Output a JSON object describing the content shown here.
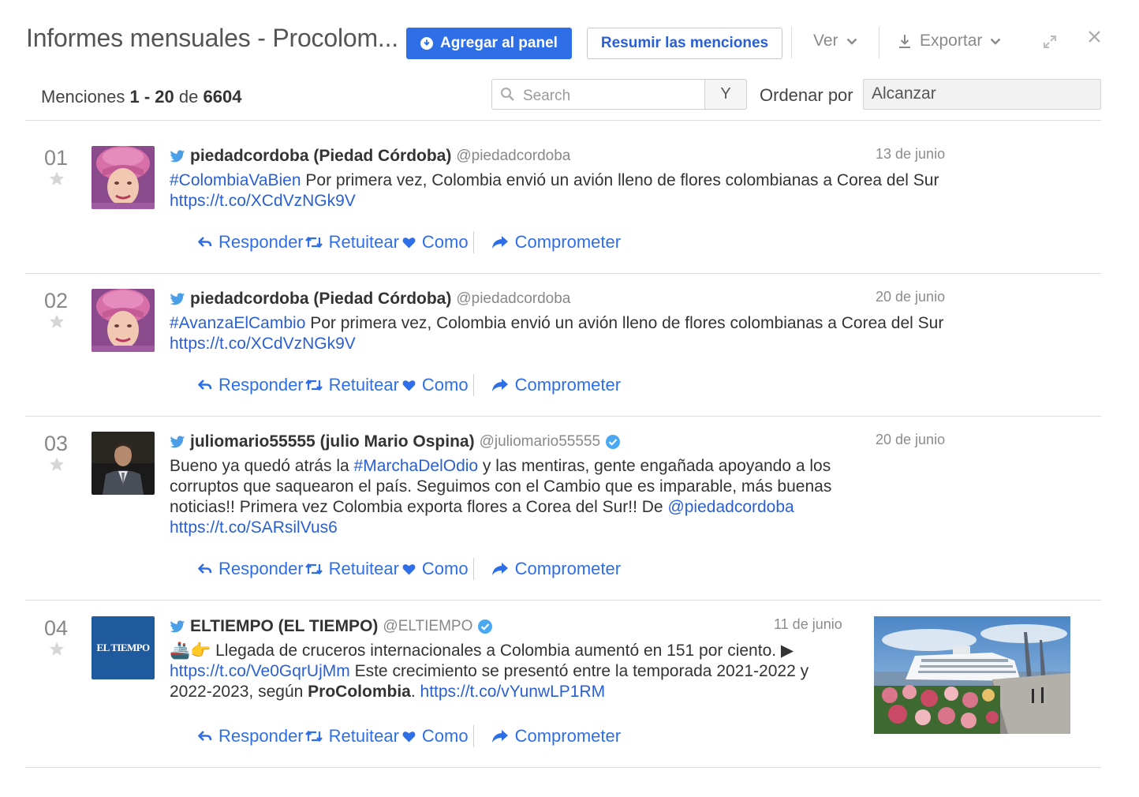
{
  "header": {
    "title": "Informes mensuales - Procolom...",
    "add_button": "Agregar al panel",
    "summarize_button": "Resumir las menciones",
    "view_menu": "Ver",
    "export_menu": "Exportar"
  },
  "toolbar": {
    "mentions_prefix": "Menciones",
    "range": "1 - 20",
    "of": "de",
    "total": "6604",
    "search_placeholder": "Search",
    "y_button": "Y",
    "sort_label": "Ordenar por",
    "sort_value": "Alcanzar"
  },
  "actions": {
    "reply": "Responder",
    "retweet": "Retuitear",
    "like": "Como",
    "engage": "Comprometer"
  },
  "mentions": [
    {
      "num": "01",
      "author": "piedadcordoba (Piedad Córdoba)",
      "handle": "@piedadcordoba",
      "verified": false,
      "date": "13 de junio",
      "text": [
        {
          "t": "#ColombiaVaBien",
          "link": true
        },
        {
          "t": " Por primera vez, Colombia envió un avión lleno de flores colombianas a Corea del Sur ",
          "link": false
        },
        {
          "t": "https://t.co/XCdVzNGk9V",
          "link": true
        }
      ]
    },
    {
      "num": "02",
      "author": "piedadcordoba (Piedad Córdoba)",
      "handle": "@piedadcordoba",
      "verified": false,
      "date": "20 de junio",
      "text": [
        {
          "t": "#AvanzaElCambio",
          "link": true
        },
        {
          "t": " Por primera vez, Colombia envió un avión lleno de flores colombianas a Corea del Sur ",
          "link": false
        },
        {
          "t": "https://t.co/XCdVzNGk9V",
          "link": true
        }
      ]
    },
    {
      "num": "03",
      "author": "juliomario55555 (julio Mario Ospina)",
      "handle": "@juliomario55555",
      "verified": true,
      "date": "20 de junio",
      "text": [
        {
          "t": "Bueno ya quedó atrás la ",
          "link": false
        },
        {
          "t": "#MarchaDelOdio",
          "link": true
        },
        {
          "t": " y las mentiras, gente engañada apoyando a los corruptos que saquearon el país. Seguimos con el Cambio que es imparable, más buenas noticias!! Primera vez Colombia exporta flores a Corea del Sur!! De ",
          "link": false
        },
        {
          "t": "@piedadcordoba",
          "link": true
        },
        {
          "t": " ",
          "link": false
        },
        {
          "t": "https://t.co/SARsilVus6",
          "link": true
        }
      ]
    },
    {
      "num": "04",
      "author": "ELTIEMPO (EL TIEMPO)",
      "handle": "@ELTIEMPO",
      "verified": true,
      "date": "11 de junio",
      "avatar_text": "EL TIEMPO",
      "text": [
        {
          "t": "🚢👉 Llegada de cruceros internacionales a Colombia aumentó en 151 por ciento. ▶ ",
          "link": false
        },
        {
          "t": "https://t.co/Ve0GqrUjMm",
          "link": true
        },
        {
          "t": " Este crecimiento se presentó entre la temporada 2021-2022 y 2022-2023, según ",
          "link": false
        },
        {
          "t": "ProColombia",
          "link": false,
          "bold": true
        },
        {
          "t": ". ",
          "link": false
        },
        {
          "t": "https://t.co/vYunwLP1RM",
          "link": true
        }
      ]
    }
  ],
  "colors": {
    "accent": "#2e6ee6",
    "link": "#2a5fd4",
    "twitter": "#4a9fe8",
    "verified": "#4aa8f0"
  }
}
